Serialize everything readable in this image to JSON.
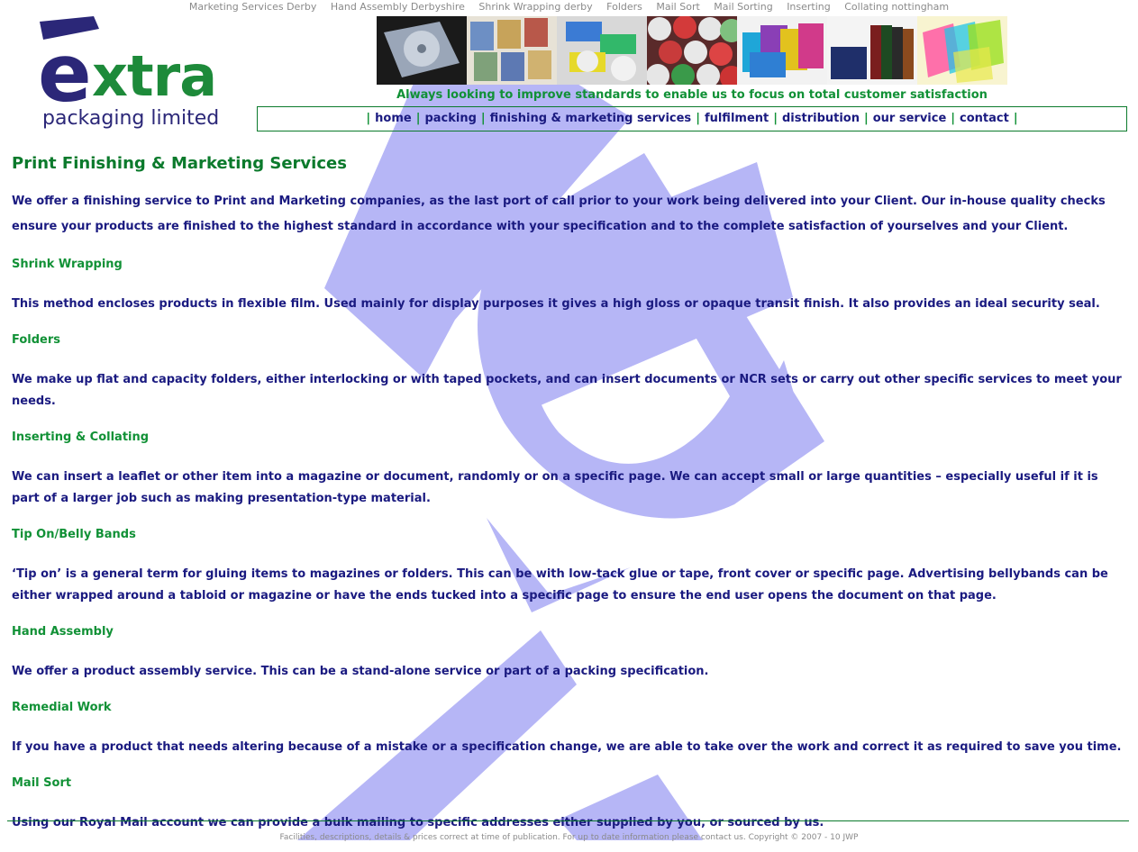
{
  "top_links": [
    "Marketing Services Derby",
    "Hand Assembly Derbyshire",
    "Shrink Wrapping derby",
    "Folders",
    "Mail Sort",
    "Mail Sorting",
    "Inserting",
    "Collating nottingham"
  ],
  "logo": {
    "letter": "e",
    "word": "xtra",
    "subtitle": "packaging limited"
  },
  "tagline": "Always looking to improve standards to enable us to focus on total customer satisfaction",
  "nav": [
    "home",
    "packing",
    "finishing & marketing services",
    "fulfilment",
    "distribution",
    "our service",
    "contact"
  ],
  "nav_separator": "|",
  "content": {
    "title": "Print Finishing & Marketing Services",
    "intro": "We offer a finishing service to Print and Marketing companies, as the last port of call prior to your work being delivered into your Client.  Our in-house quality checks ensure your products are finished to the highest standard in accordance with your specification and to the complete satisfaction of yourselves and your Client.",
    "sections": [
      {
        "heading": "Shrink Wrapping",
        "text": "This method encloses products in flexible film.  Used mainly for display purposes it gives a high gloss or opaque transit finish.  It also provides an ideal security seal."
      },
      {
        "heading": "Folders",
        "text": "We make up flat and capacity folders, either interlocking or with taped pockets, and can insert documents or NCR sets or carry out other specific services to meet your needs."
      },
      {
        "heading": "Inserting & Collating",
        "text": "We can insert a leaflet or other item into a magazine or document, randomly or on a specific page.  We can accept small or large quantities – especially useful if it is part of a larger job such as making presentation-type material."
      },
      {
        "heading": "Tip On/Belly Bands",
        "text": "‘Tip on’ is a general term for gluing items to magazines or folders.  This can be with low-tack glue or tape, front cover or specific page.  Advertising bellybands can be either wrapped around a tabloid or magazine or have the ends tucked into a specific page to ensure the end user opens the document on that page."
      },
      {
        "heading": "Hand Assembly",
        "text": "We offer a product assembly service.  This can be a stand-alone service or part of a packing specification."
      },
      {
        "heading": "Remedial Work",
        "text": "If you have a product that needs altering because of a mistake or a specification change, we are able to take over the work and correct it as required to save you time."
      },
      {
        "heading": "Mail Sort",
        "text": "Using our Royal Mail account we can provide a bulk mailing to specific addresses either supplied by you, or sourced by us."
      }
    ]
  },
  "footer": "Facilities, descriptions, details & prices correct at time of publication.  For up to date information please contact us.  Copyright © 2007 - 10  JWP",
  "colors": {
    "heading_green": "#0b7a2c",
    "link_green": "#119136",
    "text_navy": "#1a1a80",
    "watermark": "#b6b6f6",
    "logo_navy": "#2b2778"
  },
  "strip_images": [
    "cd-case-icon",
    "greeting-cards-icon",
    "label-rolls-icon",
    "wrapped-balls-icon",
    "colored-folders-icon",
    "ring-binders-icon",
    "transparent-cases-icon"
  ]
}
